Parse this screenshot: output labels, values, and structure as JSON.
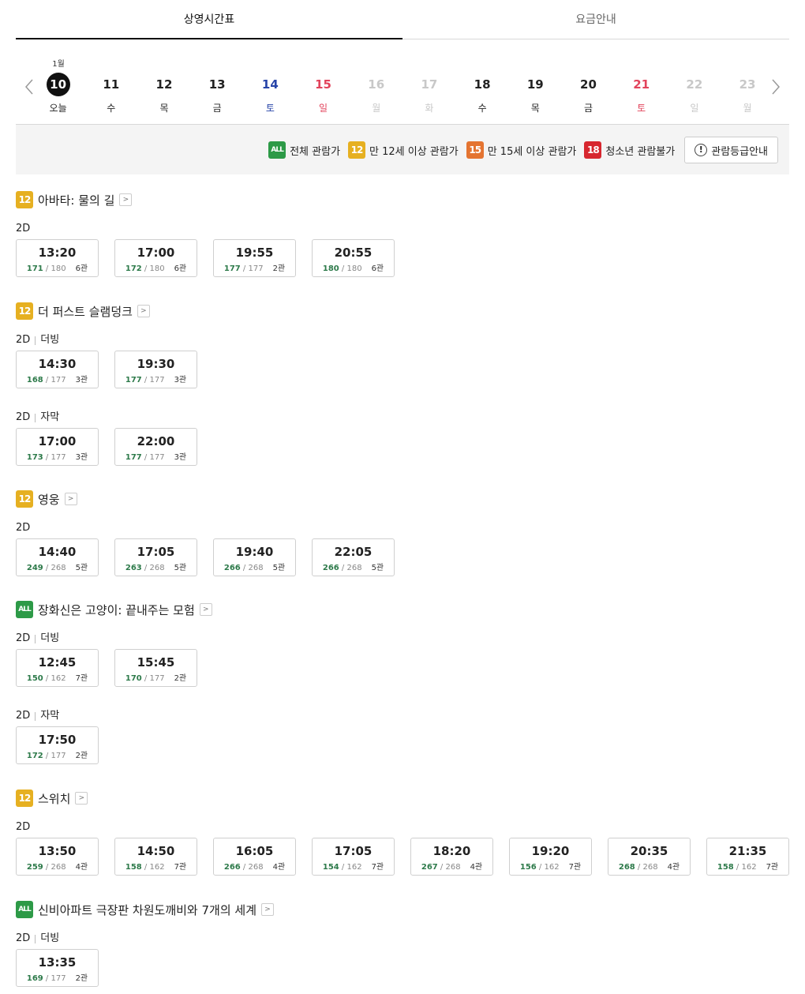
{
  "tabs": [
    "상영시간표",
    "요금안내"
  ],
  "calendar": {
    "month": "1월",
    "days": [
      {
        "num": "10",
        "wd": "오늘",
        "cls": "today"
      },
      {
        "num": "11",
        "wd": "수",
        "cls": ""
      },
      {
        "num": "12",
        "wd": "목",
        "cls": ""
      },
      {
        "num": "13",
        "wd": "금",
        "cls": ""
      },
      {
        "num": "14",
        "wd": "토",
        "cls": "sat"
      },
      {
        "num": "15",
        "wd": "일",
        "cls": "sun"
      },
      {
        "num": "16",
        "wd": "월",
        "cls": "dim"
      },
      {
        "num": "17",
        "wd": "화",
        "cls": "dim"
      },
      {
        "num": "18",
        "wd": "수",
        "cls": ""
      },
      {
        "num": "19",
        "wd": "목",
        "cls": ""
      },
      {
        "num": "20",
        "wd": "금",
        "cls": ""
      },
      {
        "num": "21",
        "wd": "토",
        "cls": "sun"
      },
      {
        "num": "22",
        "wd": "일",
        "cls": "dim"
      },
      {
        "num": "23",
        "wd": "월",
        "cls": "dim"
      }
    ]
  },
  "legend": {
    "items": [
      {
        "badge": "ALL",
        "cls": "b-all",
        "label": "전체 관람가"
      },
      {
        "badge": "12",
        "cls": "b-12",
        "label": "만 12세 이상 관람가"
      },
      {
        "badge": "15",
        "cls": "b-15",
        "label": "만 15세 이상 관람가"
      },
      {
        "badge": "18",
        "cls": "b-18",
        "label": "청소년 관람불가"
      }
    ],
    "guide_label": "관람등급안내",
    "guide_icon": "!"
  },
  "movies": [
    {
      "rating": "12",
      "rating_cls": "b-12",
      "title": "아바타: 물의 길",
      "groups": [
        {
          "format": "2D",
          "sub": "",
          "slots": [
            {
              "time": "13:20",
              "rem": "171",
              "total": "180",
              "hall": "6관"
            },
            {
              "time": "17:00",
              "rem": "172",
              "total": "180",
              "hall": "6관"
            },
            {
              "time": "19:55",
              "rem": "177",
              "total": "177",
              "hall": "2관"
            },
            {
              "time": "20:55",
              "rem": "180",
              "total": "180",
              "hall": "6관"
            }
          ]
        }
      ]
    },
    {
      "rating": "12",
      "rating_cls": "b-12",
      "title": "더 퍼스트 슬램덩크",
      "groups": [
        {
          "format": "2D",
          "sub": "더빙",
          "slots": [
            {
              "time": "14:30",
              "rem": "168",
              "total": "177",
              "hall": "3관"
            },
            {
              "time": "19:30",
              "rem": "177",
              "total": "177",
              "hall": "3관"
            }
          ]
        },
        {
          "format": "2D",
          "sub": "자막",
          "slots": [
            {
              "time": "17:00",
              "rem": "173",
              "total": "177",
              "hall": "3관"
            },
            {
              "time": "22:00",
              "rem": "177",
              "total": "177",
              "hall": "3관"
            }
          ]
        }
      ]
    },
    {
      "rating": "12",
      "rating_cls": "b-12",
      "title": "영웅",
      "groups": [
        {
          "format": "2D",
          "sub": "",
          "slots": [
            {
              "time": "14:40",
              "rem": "249",
              "total": "268",
              "hall": "5관"
            },
            {
              "time": "17:05",
              "rem": "263",
              "total": "268",
              "hall": "5관"
            },
            {
              "time": "19:40",
              "rem": "266",
              "total": "268",
              "hall": "5관"
            },
            {
              "time": "22:05",
              "rem": "266",
              "total": "268",
              "hall": "5관"
            }
          ]
        }
      ]
    },
    {
      "rating": "ALL",
      "rating_cls": "b-all",
      "title": "장화신은 고양이: 끝내주는 모험",
      "groups": [
        {
          "format": "2D",
          "sub": "더빙",
          "slots": [
            {
              "time": "12:45",
              "rem": "150",
              "total": "162",
              "hall": "7관"
            },
            {
              "time": "15:45",
              "rem": "170",
              "total": "177",
              "hall": "2관"
            }
          ]
        },
        {
          "format": "2D",
          "sub": "자막",
          "slots": [
            {
              "time": "17:50",
              "rem": "172",
              "total": "177",
              "hall": "2관"
            }
          ]
        }
      ]
    },
    {
      "rating": "12",
      "rating_cls": "b-12",
      "title": "스위치",
      "groups": [
        {
          "format": "2D",
          "sub": "",
          "slots": [
            {
              "time": "13:50",
              "rem": "259",
              "total": "268",
              "hall": "4관"
            },
            {
              "time": "14:50",
              "rem": "158",
              "total": "162",
              "hall": "7관"
            },
            {
              "time": "16:05",
              "rem": "266",
              "total": "268",
              "hall": "4관"
            },
            {
              "time": "17:05",
              "rem": "154",
              "total": "162",
              "hall": "7관"
            },
            {
              "time": "18:20",
              "rem": "267",
              "total": "268",
              "hall": "4관"
            },
            {
              "time": "19:20",
              "rem": "156",
              "total": "162",
              "hall": "7관"
            },
            {
              "time": "20:35",
              "rem": "268",
              "total": "268",
              "hall": "4관"
            },
            {
              "time": "21:35",
              "rem": "158",
              "total": "162",
              "hall": "7관"
            }
          ]
        }
      ]
    },
    {
      "rating": "ALL",
      "rating_cls": "b-all",
      "title": "신비아파트 극장판 차원도깨비와 7개의 세계",
      "groups": [
        {
          "format": "2D",
          "sub": "더빙",
          "slots": [
            {
              "time": "13:35",
              "rem": "169",
              "total": "177",
              "hall": "2관"
            }
          ]
        }
      ]
    }
  ]
}
